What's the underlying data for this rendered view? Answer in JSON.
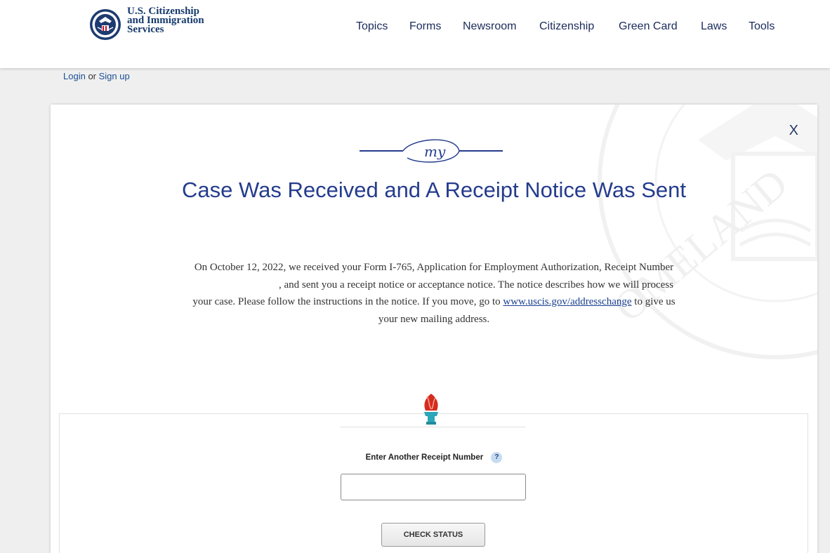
{
  "header": {
    "agency_name": [
      "U.S. Citizenship",
      "and Immigration",
      "Services"
    ],
    "nav": [
      "Topics",
      "Forms",
      "Newsroom",
      "Citizenship",
      "Green Card",
      "Laws",
      "Tools"
    ]
  },
  "auth": {
    "login_label": "Login",
    "or_label": "or",
    "signup_label": "Sign up"
  },
  "modal": {
    "close_label": "X",
    "logo_text": "my",
    "title": "Case Was Received and A Receipt Notice Was Sent",
    "body_part1": "On October 12, 2022, we received your Form I-765, Application for Employment Authorization, Receipt Number",
    "body_part2": ", and sent you a receipt notice or acceptance notice. The notice describes how we will process your case. Please follow the instructions in the notice. If you move, go to",
    "link_text": "www.uscis.gov/addresschange",
    "body_part3": "to give us your new mailing address."
  },
  "lookup": {
    "label": "Enter Another Receipt Number",
    "help_glyph": "?",
    "input_value": "",
    "button_label": "CHECK STATUS"
  },
  "colors": {
    "title_blue": "#243c8d",
    "brand_navy": "#15396c",
    "link_blue": "#1a4f95"
  }
}
